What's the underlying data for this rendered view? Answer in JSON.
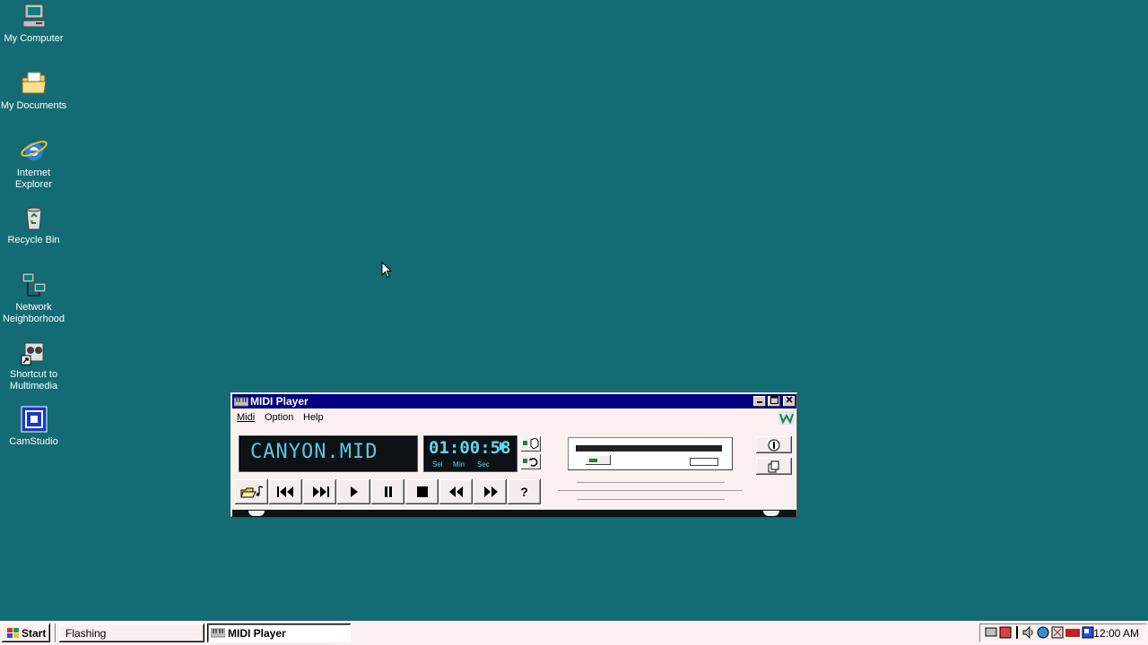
{
  "desktop": {
    "icons": [
      {
        "label": "My Computer",
        "icon": "computer-icon"
      },
      {
        "label": "My Documents",
        "icon": "folder-icon"
      },
      {
        "label": "Internet Explorer",
        "icon": "internet-explorer-icon"
      },
      {
        "label": "Recycle Bin",
        "icon": "recycle-bin-icon"
      },
      {
        "label": "Network Neighborhood",
        "icon": "network-icon"
      },
      {
        "label": "Shortcut to Multimedia",
        "icon": "multimedia-shortcut-icon"
      },
      {
        "label": "CamStudio",
        "icon": "camstudio-icon"
      }
    ]
  },
  "window": {
    "title": "MIDI Player",
    "menus": [
      "Midi",
      "Option",
      "Help"
    ],
    "display": {
      "track": "CANYON.MID",
      "time": "01:00:58",
      "labels": [
        "Sel",
        "Min",
        "Sec"
      ]
    },
    "controls": [
      "open",
      "previous-track",
      "next-track",
      "play",
      "pause",
      "stop",
      "rewind",
      "fast-forward",
      "help"
    ],
    "help_label": "?"
  },
  "taskbar": {
    "start_label": "Start",
    "tasks": [
      {
        "label": "Flashing",
        "active": false
      },
      {
        "label": "MIDI Player",
        "active": true
      }
    ],
    "clock": "12:00 AM"
  },
  "colors": {
    "desktop": "#136b73",
    "titlebar": "#000080",
    "lcd_text": "#5fc8dc"
  }
}
